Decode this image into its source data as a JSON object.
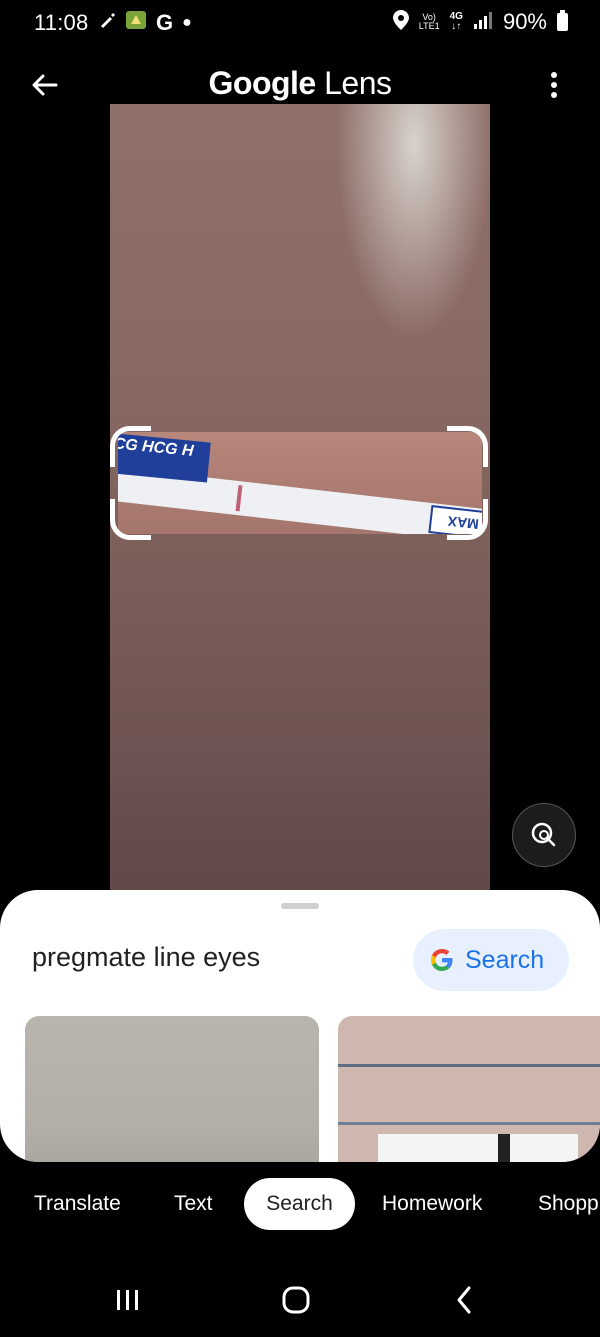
{
  "status_bar": {
    "time": "11:08",
    "left_glyph": "G",
    "volte_line1": "Vo)",
    "volte_line2": "LTE1",
    "network_line1": "4G",
    "network_line2": "↓↑",
    "battery_percent": "90%"
  },
  "app_bar": {
    "title_brand": "Google",
    "title_product": "Lens",
    "icons": [
      "back-arrow-icon",
      "more-vert-icon"
    ]
  },
  "image": {
    "strip_label": "HCG HCG H",
    "strip_end_label": "MAX"
  },
  "results_sheet": {
    "query": "pregmate line eyes",
    "search_button_label": "Search"
  },
  "modes": {
    "translate": "Translate",
    "text": "Text",
    "search": "Search",
    "homework": "Homework",
    "shopping": "Shopp",
    "selected": "Search"
  },
  "colors": {
    "accent_blue": "#1a73e8",
    "chip_bg": "#e8f0fe",
    "background": "#000000"
  }
}
